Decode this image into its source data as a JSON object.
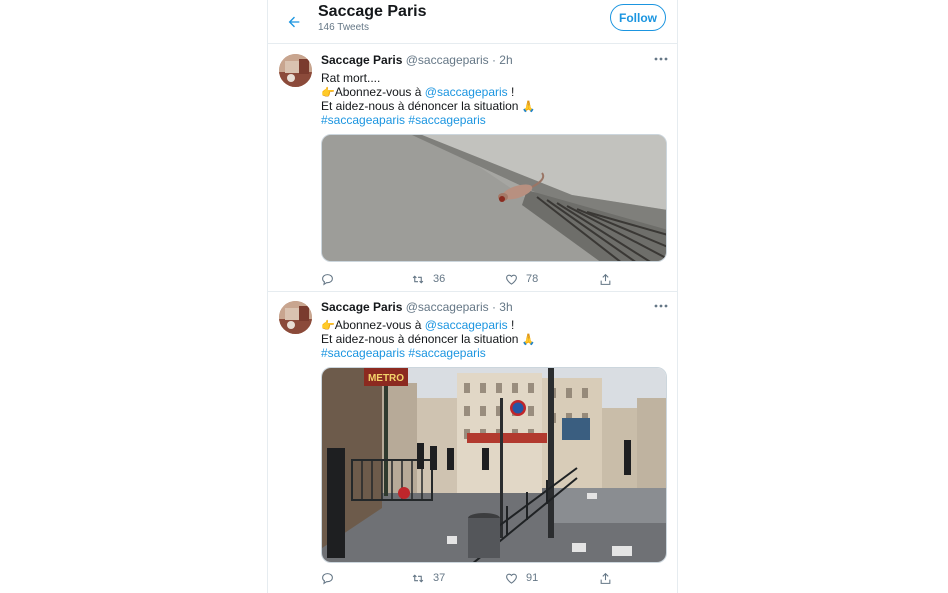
{
  "header": {
    "title": "Saccage Paris",
    "tweet_count": "146 Tweets",
    "follow_label": "Follow"
  },
  "colors": {
    "accent": "#1b95e0",
    "muted": "#657786",
    "border": "#e6ecf0"
  },
  "icons": {
    "back": "arrow-left-icon",
    "more": "more-dots-icon",
    "reply": "reply-icon",
    "retweet": "retweet-icon",
    "like": "heart-icon",
    "share": "share-icon",
    "pointing": "pointing-hand-emoji",
    "pray": "praying-hands-emoji"
  },
  "tweets": [
    {
      "name": "Saccage Paris",
      "handle": "@saccageparis · 2h",
      "line1": "Rat mort....",
      "abonnez_pre": "Abonnez-vous à ",
      "mention": "@saccageparis",
      "abonnez_post": " !",
      "aidez": "Et aidez-nous à dénoncer la situation ",
      "hashtag1": "#saccageaparis",
      "hashtag2": "#saccageparis",
      "media_description": "rat on sidewalk by drain",
      "retweets": "36",
      "likes": "78"
    },
    {
      "name": "Saccage Paris",
      "handle": "@saccageparis · 3h",
      "abonnez_pre": "Abonnez-vous à ",
      "mention": "@saccageparis",
      "abonnez_post": " !",
      "aidez": "Et aidez-nous à dénoncer la situation ",
      "hashtag1": "#saccageaparis",
      "hashtag2": "#saccageparis",
      "metro_sign": "METRO",
      "retweets": "37",
      "likes": "91"
    }
  ]
}
